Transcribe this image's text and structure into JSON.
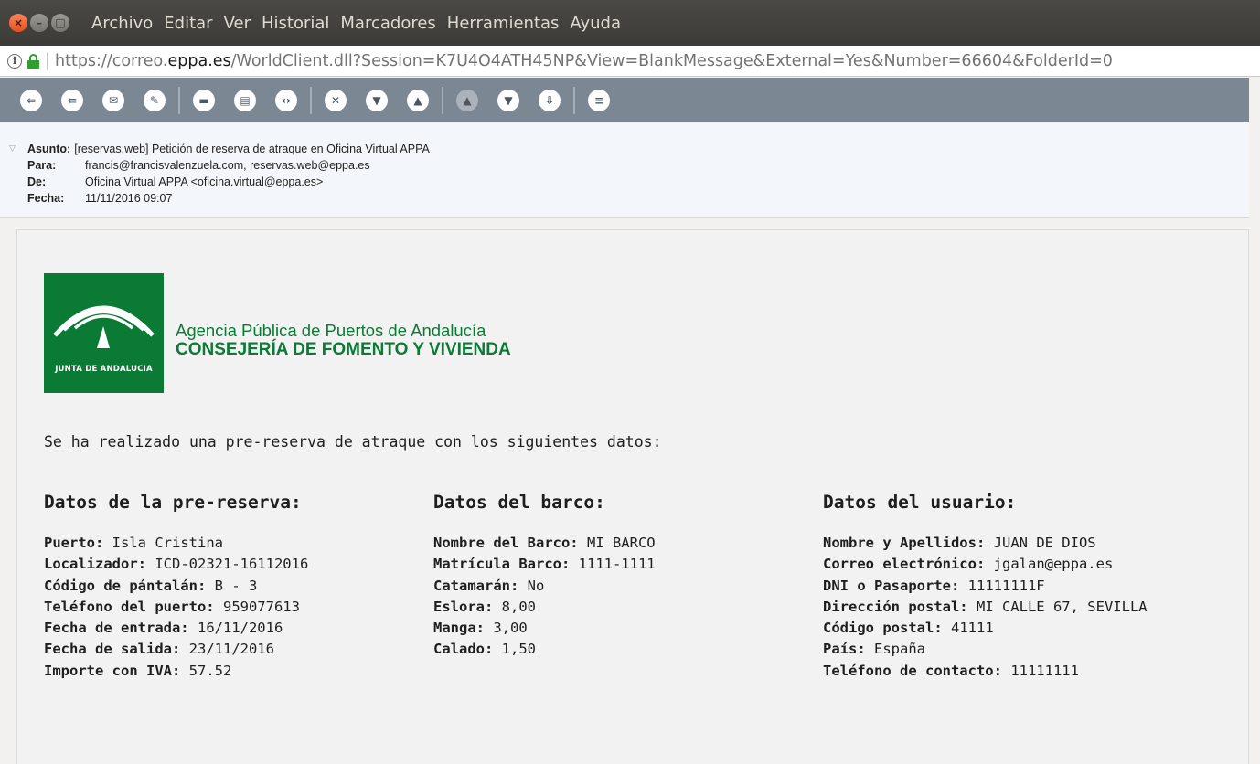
{
  "window": {
    "menu": [
      "Archivo",
      "Editar",
      "Ver",
      "Historial",
      "Marcadores",
      "Herramientas",
      "Ayuda"
    ]
  },
  "urlbar": {
    "url_prefix": "https://correo.",
    "url_domain": "eppa.es",
    "url_rest": "/WorldClient.dll?Session=K7U4O4ATH45NP&View=BlankMessage&External=Yes&Number=66604&FolderId=0"
  },
  "toolbar": {
    "icons": [
      "reply-icon",
      "reply-all-icon",
      "forward-icon",
      "forward-attachment-icon",
      "print-icon",
      "save-icon",
      "source-icon",
      "delete-icon",
      "mark-spam-icon",
      "not-spam-icon",
      "previous-icon",
      "next-icon",
      "move-icon",
      "menu-icon"
    ]
  },
  "headers": {
    "subject_label": "Asunto:",
    "subject": "[reservas.web] Petición de reserva de atraque en Oficina Virtual APPA",
    "to_label": "Para:",
    "to": "francis@francisvalenzuela.com, reservas.web@eppa.es",
    "from_label": "De:",
    "from": "Oficina Virtual APPA <oficina.virtual@eppa.es>",
    "date_label": "Fecha:",
    "date": "11/11/2016 09:07"
  },
  "logo": {
    "text": "JUNTA DE ANDALUCIA",
    "agency_line1": "Agencia Pública de Puertos de Andalucía",
    "agency_line2": "CONSEJERÍA DE FOMENTO Y VIVIENDA"
  },
  "body": {
    "intro": "Se ha realizado una pre-reserva de atraque con los siguientes datos:",
    "reserva": {
      "title": "Datos de la pre-reserva:",
      "fields": [
        {
          "label": "Puerto:",
          "value": "Isla Cristina"
        },
        {
          "label": "Localizador:",
          "value": "ICD-02321-16112016"
        },
        {
          "label": "Código de pántalán:",
          "value": "B - 3"
        },
        {
          "label": "Teléfono del puerto:",
          "value": "959077613"
        },
        {
          "label": "Fecha de entrada:",
          "value": "16/11/2016"
        },
        {
          "label": "Fecha de salida:",
          "value": "23/11/2016"
        },
        {
          "label": "Importe con IVA:",
          "value": "57.52"
        }
      ]
    },
    "barco": {
      "title": "Datos del barco:",
      "fields": [
        {
          "label": "Nombre del Barco:",
          "value": "MI BARCO"
        },
        {
          "label": "Matrícula Barco:",
          "value": "1111-1111"
        },
        {
          "label": "Catamarán:",
          "value": "No"
        },
        {
          "label": "Eslora:",
          "value": "8,00"
        },
        {
          "label": "Manga:",
          "value": "3,00"
        },
        {
          "label": "Calado:",
          "value": "1,50"
        }
      ]
    },
    "usuario": {
      "title": "Datos del usuario:",
      "fields": [
        {
          "label": "Nombre y Apellidos:",
          "value": "JUAN DE DIOS"
        },
        {
          "label": "Correo electrónico:",
          "value": "jgalan@eppa.es"
        },
        {
          "label": "DNI o Pasaporte:",
          "value": "11111111F"
        },
        {
          "label": "Dirección postal:",
          "value": "MI CALLE 67, SEVILLA"
        },
        {
          "label": "Código postal:",
          "value": "41111"
        },
        {
          "label": "País:",
          "value": "España"
        },
        {
          "label": "Teléfono de contacto:",
          "value": "11111111"
        }
      ]
    }
  }
}
